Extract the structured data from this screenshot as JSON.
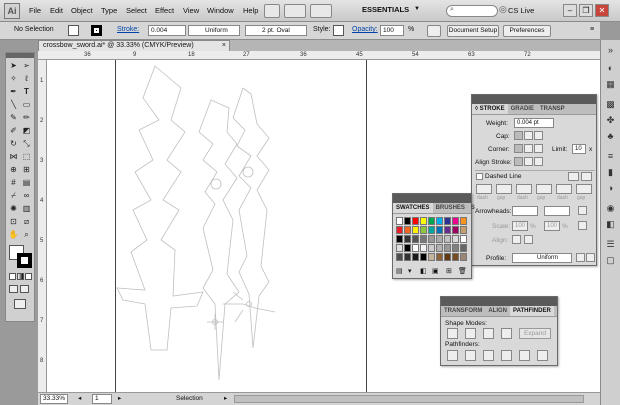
{
  "app": {
    "logo": "Ai"
  },
  "menu": [
    "File",
    "Edit",
    "Object",
    "Type",
    "Select",
    "Effect",
    "View",
    "Window",
    "Help"
  ],
  "workspace": "ESSENTIALS",
  "cslive": "CS Live",
  "window_controls": [
    "–",
    "❐",
    "✕"
  ],
  "control_bar": {
    "selection": "No Selection",
    "stroke_label": "Stroke:",
    "stroke_value": "0.004",
    "profile": "Uniform",
    "brush": "2 pt. Oval",
    "style_label": "Style:",
    "opacity_label": "Opacity:",
    "opacity_value": "100",
    "opacity_unit": "%",
    "doc_setup": "Document Setup",
    "preferences": "Preferences"
  },
  "document": {
    "tab": "crossbow_sword.ai* @ 33.33% (CMYK/Preview)"
  },
  "ruler_top": [
    "36",
    "9",
    "18",
    "27",
    "36",
    "45",
    "54",
    "63",
    "72"
  ],
  "ruler_left": [
    "1",
    "2",
    "3",
    "4",
    "5",
    "6",
    "7",
    "8"
  ],
  "stroke_panel": {
    "tabs": [
      "◊ STROKE",
      "GRADIE",
      "TRANSP"
    ],
    "weight_label": "Weight:",
    "weight_value": "0.004 pt",
    "cap_label": "Cap:",
    "corner_label": "Corner:",
    "limit_label": "Limit:",
    "limit_value": "10",
    "limit_unit": "x",
    "align_label": "Align Stroke:",
    "dashed_label": "Dashed Line",
    "dash_fields": [
      "dash",
      "gap",
      "dash",
      "gap",
      "dash",
      "gap"
    ],
    "arrowheads_label": "Arrowheads:",
    "scale_label": "Scale:",
    "scale_values": [
      "100",
      "100"
    ],
    "scale_unit": "%",
    "align_arrow_label": "Align:",
    "profile_label": "Profile:",
    "profile_value": "Uniform"
  },
  "swatches_panel": {
    "tabs": [
      "SWATCHES",
      "BRUSHES",
      "S"
    ],
    "rows": [
      [
        "#ffffff",
        "#000000",
        "#ff0000",
        "#ffff00",
        "#00a651",
        "#00aeef",
        "#2e3192",
        "#ec008c",
        "#f7941d"
      ],
      [
        "#ed1c24",
        "#f26522",
        "#fff200",
        "#8dc63f",
        "#00a99d",
        "#0072bc",
        "#662d91",
        "#9e005d",
        "#c69c6d"
      ],
      [
        "#000000",
        "#333333",
        "#555555",
        "#777777",
        "#999999",
        "#aaaaaa",
        "#c0c0c0",
        "#d9d9d9",
        "#ffffff"
      ],
      [
        "#e0e0e0",
        "#000000",
        "#ffffff",
        "#f2f2f2",
        "#cccccc",
        "#b3b3b3",
        "#999999",
        "#808080",
        "#666666"
      ],
      [
        "#4d4d4d",
        "#333333",
        "#1a1a1a",
        "#000000",
        "#c2b59b",
        "#8c6239",
        "#603913",
        "#754c24",
        "#998675"
      ]
    ]
  },
  "pathfinder_panel": {
    "tabs": [
      "TRANSFORM",
      "ALIGN",
      "PATHFINDER"
    ],
    "shape_modes_label": "Shape Modes:",
    "expand_label": "Expand",
    "pathfinders_label": "Pathfinders:"
  },
  "status": {
    "zoom": "33.33%",
    "page": "1",
    "tool": "Selection"
  }
}
